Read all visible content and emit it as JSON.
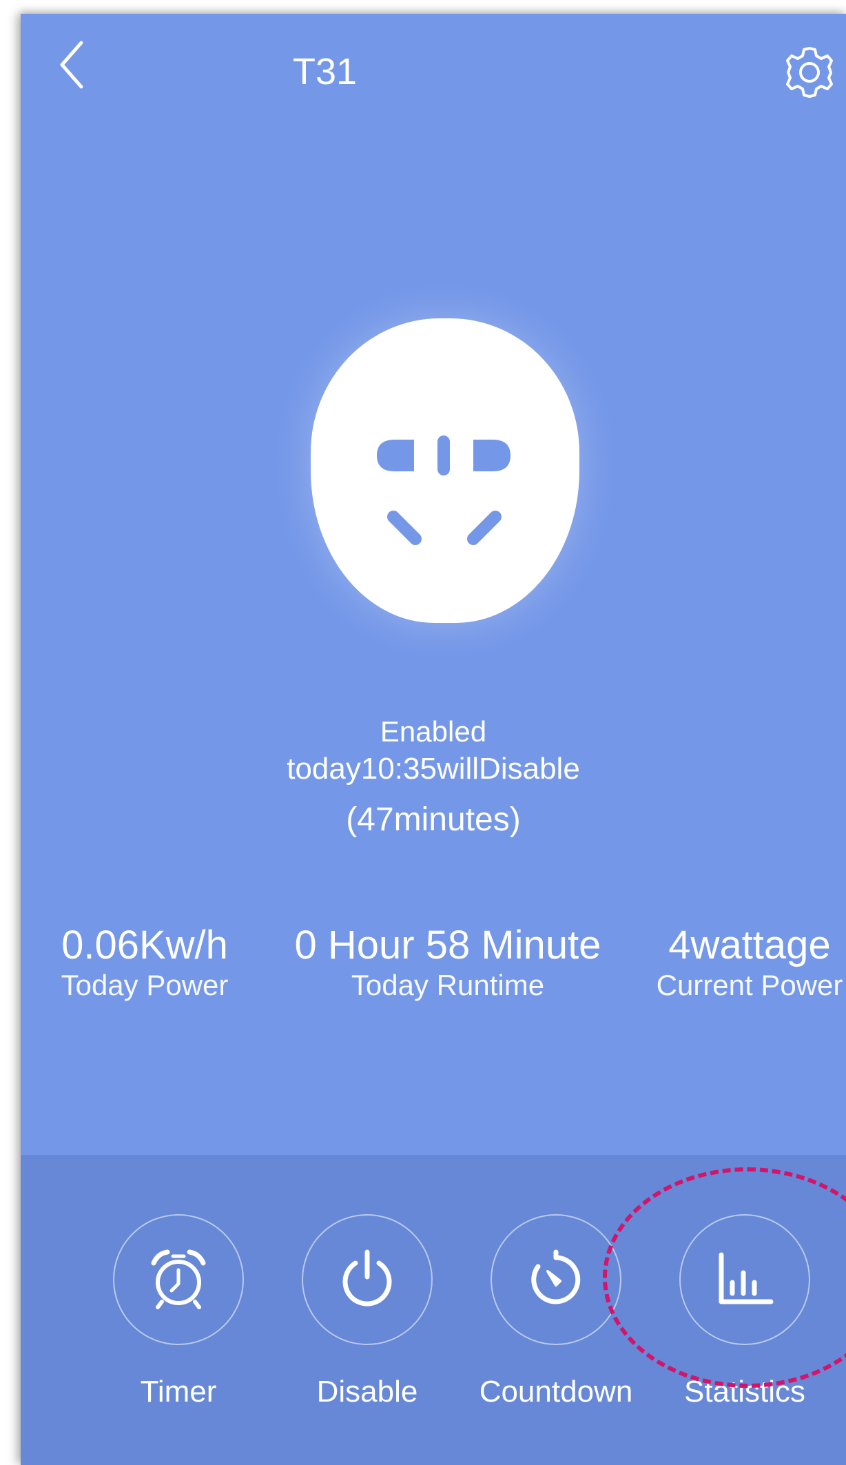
{
  "header": {
    "title": "T31",
    "back_icon": "chevron-left-icon",
    "settings_icon": "gear-icon"
  },
  "device": {
    "icon": "power-outlet-icon"
  },
  "status": {
    "state": "Enabled",
    "schedule": "today10:35willDisable",
    "remaining": "(47minutes)"
  },
  "stats": [
    {
      "value": "0.06Kw/h",
      "label": "Today Power"
    },
    {
      "value": "0 Hour 58 Minute",
      "label": "Today Runtime"
    },
    {
      "value": "4wattage",
      "label": "Current Power"
    }
  ],
  "actions": [
    {
      "label": "Timer",
      "icon": "alarm-clock-icon"
    },
    {
      "label": "Disable",
      "icon": "power-icon"
    },
    {
      "label": "Countdown",
      "icon": "countdown-icon"
    },
    {
      "label": "Statistics",
      "icon": "bar-chart-icon"
    }
  ],
  "colors": {
    "background": "#7497e8",
    "bottom_bar": "#6688d6",
    "highlight": "#d4136a"
  }
}
